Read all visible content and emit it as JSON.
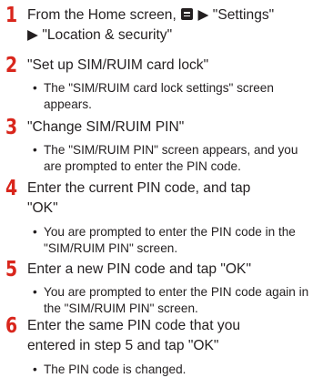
{
  "steps": [
    {
      "number": "1",
      "lines": [
        [
          "From the Home screen, ",
          " ▶ \"Settings\""
        ],
        "▶ \"Location & security\""
      ],
      "menu_icon": "menu-key-icon",
      "bullets": []
    },
    {
      "number": "2",
      "lines": [
        "\"Set up SIM/RUIM card lock\""
      ],
      "bullets": [
        {
          "lines": [
            "The \"SIM/RUIM card lock settings\" screen",
            "appears."
          ]
        }
      ]
    },
    {
      "number": "3",
      "lines": [
        "\"Change SIM/RUIM PIN\""
      ],
      "bullets": [
        {
          "lines": [
            "The \"SIM/RUIM PIN\" screen appears, and you",
            "are prompted to enter the PIN code."
          ]
        }
      ]
    },
    {
      "number": "4",
      "lines": [
        "Enter the current PIN code, and tap",
        "\"OK\""
      ],
      "bullets": [
        {
          "lines": [
            "You are prompted to enter the PIN code in the",
            "\"SIM/RUIM PIN\" screen."
          ]
        }
      ]
    },
    {
      "number": "5",
      "lines": [
        "Enter a new PIN code and tap \"OK\""
      ],
      "bullets": [
        {
          "lines": [
            "You are prompted to enter the PIN code again in",
            "the \"SIM/RUIM PIN\" screen."
          ]
        }
      ]
    },
    {
      "number": "6",
      "lines": [
        "Enter the same PIN code that you",
        "entered in step 5 and tap \"OK\""
      ],
      "bullets": [
        {
          "lines": [
            "The PIN code is changed."
          ]
        }
      ]
    }
  ],
  "bullet_glyph": "•",
  "colors": {
    "step_number": "#d9261c",
    "text": "#231f20"
  }
}
